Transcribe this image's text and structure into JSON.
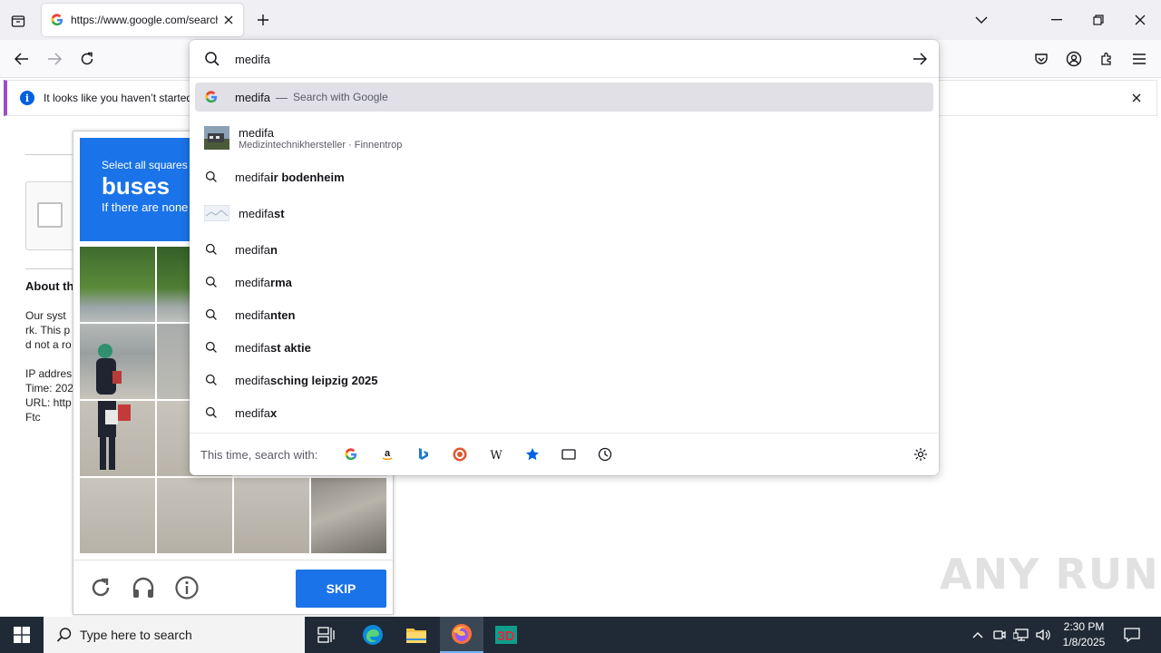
{
  "browser": {
    "tab": {
      "title": "https://www.google.com/search"
    },
    "notification": {
      "text": "It looks like you haven’t started"
    }
  },
  "urlbar": {
    "value": "medifa",
    "results": [
      {
        "prefix": "medifa",
        "bold": "",
        "suffix": "Search with Google",
        "type": "search-google",
        "selected": true
      },
      {
        "prefix": "medifa",
        "bold": "",
        "subtitle": "Medizintechnikhersteller · Finnentrop",
        "type": "entity"
      },
      {
        "prefix": "medifa",
        "bold": "ir bodenheim",
        "type": "suggestion"
      },
      {
        "prefix": "medifa",
        "bold": "st",
        "type": "entity-thumb"
      },
      {
        "prefix": "medifa",
        "bold": "n",
        "type": "suggestion"
      },
      {
        "prefix": "medifa",
        "bold": "rma",
        "type": "suggestion"
      },
      {
        "prefix": "medifa",
        "bold": "nten",
        "type": "suggestion"
      },
      {
        "prefix": "medifa",
        "bold": "st aktie",
        "type": "suggestion"
      },
      {
        "prefix": "medifa",
        "bold": "sching leipzig 2025",
        "type": "suggestion"
      },
      {
        "prefix": "medifa",
        "bold": "x",
        "type": "suggestion"
      }
    ],
    "oneoff_label": "This time, search with:",
    "engines": [
      "google-icon",
      "amazon-icon",
      "bing-icon",
      "duckduckgo-icon",
      "wikipedia-icon",
      "bookmarks-icon",
      "tabs-icon",
      "history-icon"
    ]
  },
  "page": {
    "heading": "About th",
    "lines": [
      "Our syst",
      "rk. This p",
      "d not a ro",
      "IP addres",
      "Time: 202",
      "URL: http",
      "Ftc"
    ]
  },
  "captcha": {
    "line1": "Select all squares",
    "line2": "buses",
    "line3": "If there are none",
    "skip_label": "SKIP",
    "accent": "#1a73e8"
  },
  "taskbar": {
    "search_placeholder": "Type here to search",
    "time": "2:30 PM",
    "date": "1/8/2025"
  },
  "watermark": "ANY RUN"
}
